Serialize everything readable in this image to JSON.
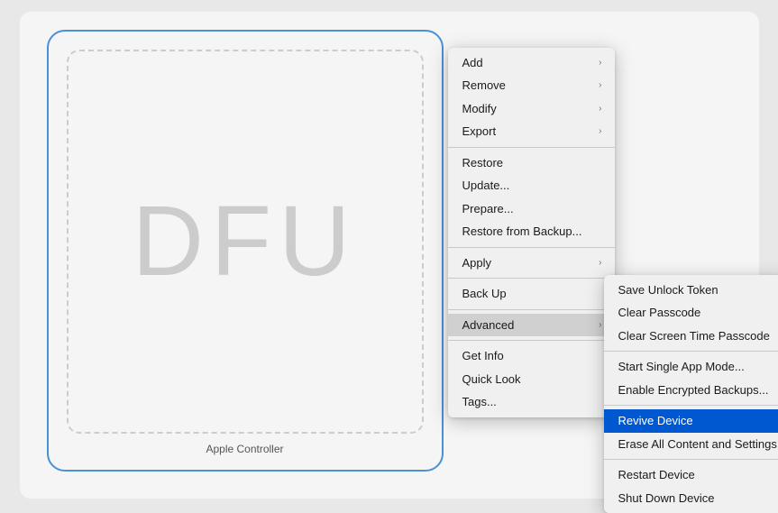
{
  "device": {
    "label": "Apple Controller",
    "dfu_text": "DFU"
  },
  "primary_menu": {
    "items": [
      {
        "id": "add",
        "label": "Add",
        "has_submenu": true
      },
      {
        "id": "remove",
        "label": "Remove",
        "has_submenu": true
      },
      {
        "id": "modify",
        "label": "Modify",
        "has_submenu": true
      },
      {
        "id": "export",
        "label": "Export",
        "has_submenu": true
      },
      {
        "id": "sep1",
        "type": "divider"
      },
      {
        "id": "restore",
        "label": "Restore"
      },
      {
        "id": "update",
        "label": "Update..."
      },
      {
        "id": "prepare",
        "label": "Prepare..."
      },
      {
        "id": "restore-backup",
        "label": "Restore from Backup..."
      },
      {
        "id": "sep2",
        "type": "divider"
      },
      {
        "id": "apply",
        "label": "Apply",
        "has_submenu": true
      },
      {
        "id": "sep3",
        "type": "divider"
      },
      {
        "id": "back-up",
        "label": "Back Up"
      },
      {
        "id": "sep4",
        "type": "divider"
      },
      {
        "id": "advanced",
        "label": "Advanced",
        "has_submenu": true,
        "active": true
      },
      {
        "id": "sep5",
        "type": "divider"
      },
      {
        "id": "get-info",
        "label": "Get Info"
      },
      {
        "id": "quick-look",
        "label": "Quick Look"
      },
      {
        "id": "tags",
        "label": "Tags..."
      }
    ]
  },
  "secondary_menu": {
    "items": [
      {
        "id": "save-unlock-token",
        "label": "Save Unlock Token"
      },
      {
        "id": "clear-passcode",
        "label": "Clear Passcode"
      },
      {
        "id": "clear-screen-time",
        "label": "Clear Screen Time Passcode"
      },
      {
        "id": "sep1",
        "type": "divider"
      },
      {
        "id": "single-app-mode",
        "label": "Start Single App Mode..."
      },
      {
        "id": "encrypted-backups",
        "label": "Enable Encrypted Backups..."
      },
      {
        "id": "sep2",
        "type": "divider"
      },
      {
        "id": "revive-device",
        "label": "Revive Device",
        "highlighted": true
      },
      {
        "id": "erase-all",
        "label": "Erase All Content and Settings"
      },
      {
        "id": "sep3",
        "type": "divider"
      },
      {
        "id": "restart-device",
        "label": "Restart Device"
      },
      {
        "id": "shut-down",
        "label": "Shut Down Device"
      }
    ]
  }
}
